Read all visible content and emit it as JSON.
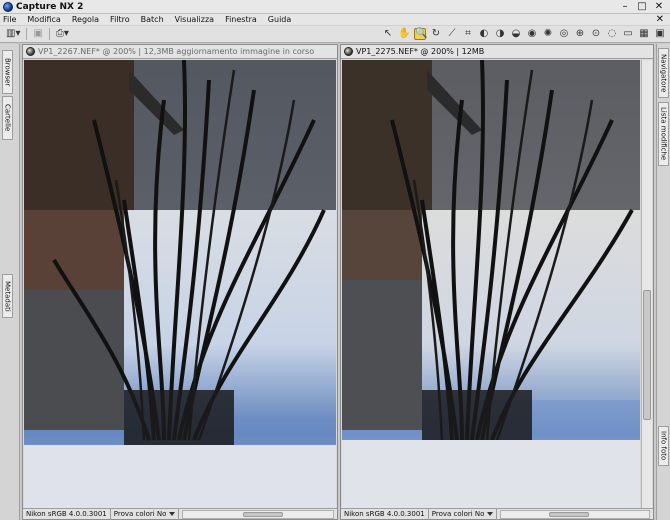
{
  "app": {
    "title": "Capture NX 2",
    "window_controls": {
      "minimize": "–",
      "maximize": "□",
      "close": "✕"
    }
  },
  "menu": {
    "items": [
      "File",
      "Modifica",
      "Regola",
      "Filtro",
      "Batch",
      "Visualizza",
      "Finestra",
      "Guida"
    ],
    "close_glyph": "✕"
  },
  "toolbar": {
    "left_icons": [
      "layout-icon",
      "browser-icon",
      "print-icon"
    ],
    "right_tools": [
      {
        "name": "direct-select-icon",
        "glyph": "↖"
      },
      {
        "name": "hand-icon",
        "glyph": "✋"
      },
      {
        "name": "zoom-icon",
        "glyph": "🔍",
        "active": true
      },
      {
        "name": "rotate-icon",
        "glyph": "↻"
      },
      {
        "name": "straighten-icon",
        "glyph": "⟋"
      },
      {
        "name": "crop-icon",
        "glyph": "⌗"
      },
      {
        "name": "black-point-icon",
        "glyph": "◐"
      },
      {
        "name": "neutral-point-icon",
        "glyph": "◑"
      },
      {
        "name": "white-point-icon",
        "glyph": "◒"
      },
      {
        "name": "red-eye-icon",
        "glyph": "◉"
      },
      {
        "name": "auto-retouch-icon",
        "glyph": "✺"
      },
      {
        "name": "view-icon",
        "glyph": "◎"
      },
      {
        "name": "color-control-point-icon",
        "glyph": "⊕"
      },
      {
        "name": "selection-brush-icon",
        "glyph": "⊙"
      },
      {
        "name": "lasso-icon",
        "glyph": "◌"
      },
      {
        "name": "marquee-icon",
        "glyph": "▭"
      },
      {
        "name": "gradient-icon",
        "glyph": "▦"
      },
      {
        "name": "fill-icon",
        "glyph": "▣"
      }
    ]
  },
  "panels": {
    "left_tabs": [
      "Browser",
      "Cartelle",
      "Metadati"
    ],
    "right_tabs": [
      "Navigatore",
      "Lista modifiche",
      "Info foto"
    ]
  },
  "windows": [
    {
      "title": "VP1_2267.NEF* @ 200% | 12,3MB aggiornamento immagine in corso",
      "status": {
        "profile": "Nikon sRGB 4.0.0.3001",
        "proof": "Prova colori No"
      }
    },
    {
      "title": "VP1_2275.NEF* @ 200% | 12MB",
      "status": {
        "profile": "Nikon sRGB 4.0.0.3001",
        "proof": "Prova colori No"
      }
    }
  ],
  "colors": {
    "accent_active_tool": "#f2d24a",
    "chrome": "#e1e1e1"
  }
}
